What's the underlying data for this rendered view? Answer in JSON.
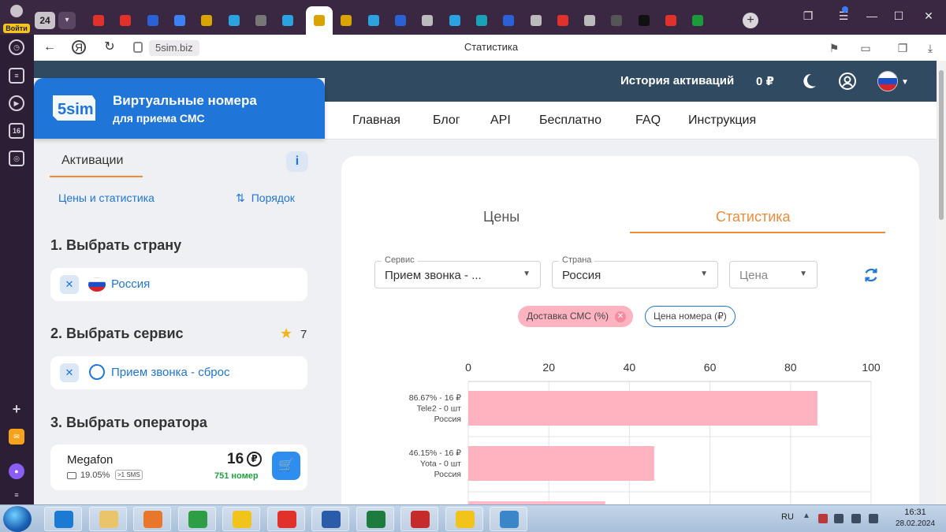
{
  "browser": {
    "profile_label": "Войти",
    "tab_count": "24",
    "domain": "5sim.biz",
    "page_title": "Статистика",
    "tab_icons": [
      "yandex-icon",
      "yandex-icon",
      "note-icon",
      "mail-icon",
      "sim-icon",
      "telegram-icon",
      "chatgpt-icon",
      "telegram-icon",
      "sim-icon",
      "sim-icon",
      "telegram-icon",
      "chart-icon",
      "document-icon",
      "telegram-icon",
      "chat-icon",
      "power-icon",
      "document-icon",
      "yandex-icon",
      "globe-icon",
      "terminal-icon",
      "star-icon",
      "yandex-icon",
      "image-icon"
    ],
    "tab_colors": [
      "#e0312a",
      "#e0312a",
      "#2a62d6",
      "#3b82f6",
      "#d9a400",
      "#2aa3e0",
      "#777777",
      "#2aa3e0",
      "#d9a400",
      "#d9a400",
      "#2aa3e0",
      "#2a62d6",
      "#bbbbbb",
      "#2aa3e0",
      "#1aa3b8",
      "#2a62d6",
      "#bbbbbb",
      "#e0312a",
      "#bbbbbb",
      "#555555",
      "#111111",
      "#e0312a",
      "#1c9a3c"
    ]
  },
  "site": {
    "header": {
      "history_label": "История активаций",
      "balance": "0 ₽"
    },
    "nav": [
      "Главная",
      "Блог",
      "API",
      "Бесплатно",
      "FAQ",
      "Инструкция"
    ],
    "logo": {
      "mark": "5sim",
      "title": "Виртуальные номера",
      "subtitle": "для приема СМС"
    },
    "left": {
      "activations_tab": "Активации",
      "info_label": "i",
      "prices_link": "Цены и статистика",
      "order_link": "Порядок",
      "step1": "1. Выбрать страну",
      "country": "Россия",
      "step2": "2. Выбрать сервис",
      "favorites_count": "7",
      "service": "Прием звонка - сброс",
      "step3": "3. Выбрать оператора",
      "operator": {
        "name": "Megafon",
        "rate": "19.05%",
        "sms_badge": ">1 SMS",
        "price": "16",
        "currency": "₽",
        "count": "751 номер"
      }
    },
    "stats": {
      "tab_prices": "Цены",
      "tab_statistics": "Статистика",
      "service_label": "Сервис",
      "service_value": "Прием звонка - ...",
      "country_label": "Страна",
      "country_value": "Россия",
      "price_placeholder": "Цена",
      "chip_delivery": "Доставка СМС (%)",
      "chip_price": "Цена номера (₽)"
    }
  },
  "chart_data": {
    "type": "bar",
    "orientation": "horizontal",
    "xlim": [
      0,
      100
    ],
    "x_ticks": [
      "0",
      "20",
      "40",
      "60",
      "80",
      "100"
    ],
    "bar_color": "#ffb3c1",
    "grid": true,
    "categories": [
      [
        "86.67% - 16 ₽",
        "Tele2 - 0 шт",
        "Россия"
      ],
      [
        "46.15% - 16 ₽",
        "Yota - 0 шт",
        "Россия"
      ]
    ],
    "values": [
      86.67,
      46.15
    ]
  },
  "taskbar": {
    "apps": [
      "ie-icon",
      "folder-icon",
      "media-icon",
      "chrome-icon",
      "yandex-browser-icon",
      "yandex-icon",
      "word-icon",
      "excel-icon",
      "acrobat-icon",
      "1c-icon",
      "image-viewer-icon"
    ],
    "app_colors": [
      "#1a7ad4",
      "#e9c46a",
      "#e8762b",
      "#2e9e44",
      "#f2c31b",
      "#e0312a",
      "#2a5caa",
      "#1e7b3e",
      "#c62b2b",
      "#f2c31b",
      "#3a86c8"
    ],
    "language": "RU",
    "time": "16:31",
    "date": "28.02.2024"
  }
}
